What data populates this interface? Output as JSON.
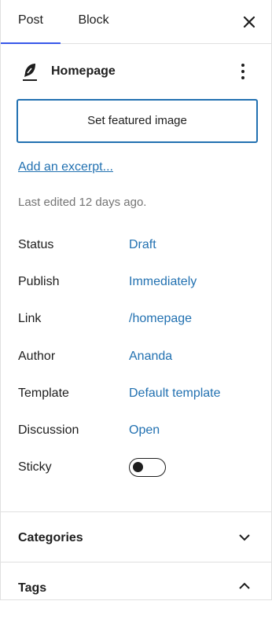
{
  "tabs": {
    "post": "Post",
    "block": "Block"
  },
  "close_icon": "close-icon",
  "header": {
    "title": "Homepage",
    "icon": "feather-icon",
    "menu_icon": "more-vertical-icon"
  },
  "featured_image": {
    "label": "Set featured image"
  },
  "excerpt": {
    "label": "Add an excerpt..."
  },
  "last_edited": "Last edited 12 days ago.",
  "meta": [
    {
      "label": "Status",
      "value": "Draft"
    },
    {
      "label": "Publish",
      "value": "Immediately"
    },
    {
      "label": "Link",
      "value": "/homepage"
    },
    {
      "label": "Author",
      "value": "Ananda"
    },
    {
      "label": "Template",
      "value": "Default template"
    },
    {
      "label": "Discussion",
      "value": "Open"
    }
  ],
  "sticky": {
    "label": "Sticky",
    "checked": false
  },
  "sections": [
    {
      "title": "Categories",
      "expanded": false,
      "icon": "chevron-down-icon"
    },
    {
      "title": "Tags",
      "expanded": true,
      "icon": "chevron-up-icon"
    }
  ],
  "colors": {
    "link": "#2271b1",
    "accent": "#3858e9",
    "text": "#1e1e1e",
    "muted": "#757575"
  }
}
